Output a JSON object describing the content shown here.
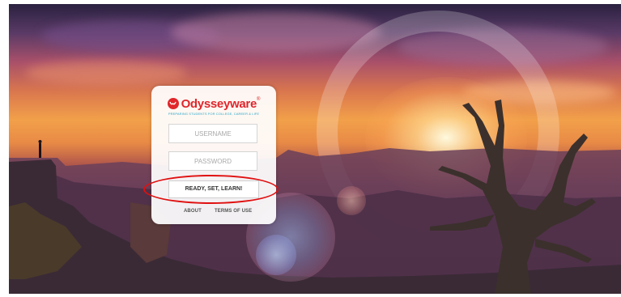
{
  "logo": {
    "brand": "Odysseyware",
    "trademark": "®",
    "tagline": "PREPARING STUDENTS FOR COLLEGE, CAREER & LIFE"
  },
  "login": {
    "username_placeholder": "USERNAME",
    "username_value": "",
    "password_placeholder": "PASSWORD",
    "password_value": "",
    "submit_label": "READY, SET, LEARN!"
  },
  "footer_links": {
    "about": "ABOUT",
    "terms": "TERMS OF USE"
  },
  "colors": {
    "brand_red": "#e0262c",
    "tagline_teal": "#2aa6c8",
    "annotation_red": "#e01010"
  },
  "icons": {
    "logo_mark": "odysseyware-logo-icon"
  }
}
